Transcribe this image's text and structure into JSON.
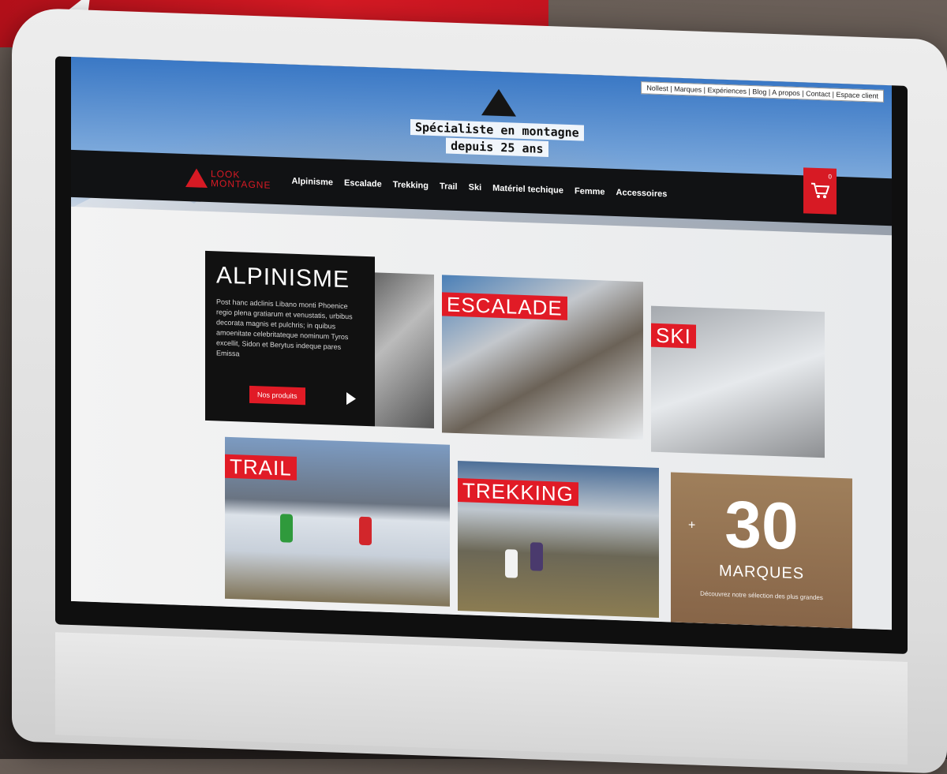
{
  "site": {
    "brand_line1": "LOOK",
    "brand_line2": "MONTAGNE",
    "top_links": "Nollest | Marques | Expériences | Blog | A propos | Contact | Espace client",
    "tagline_line1": "Spécialiste en montagne",
    "tagline_line2": "depuis 25 ans"
  },
  "nav": {
    "items": [
      "Alpinisme",
      "Escalade",
      "Trekking",
      "Trail",
      "Ski",
      "Matériel techique",
      "Femme",
      "Accessoires"
    ]
  },
  "cart": {
    "count": "0",
    "icon": "cart-icon"
  },
  "alpinisme": {
    "title": "ALPINISME",
    "text": "Post hanc adclinis Libano monti Phoenice regio plena gratiarum et venustatis, urbibus decorata magnis et pulchris; in quibus amoenitate celebritateque nominum Tyros excellit, Sidon et Berytus indeque pares Emissa",
    "button": "Nos produits"
  },
  "tiles": {
    "escalade": "ESCALADE",
    "ski": "SKI",
    "trail": "TRAIL",
    "trekking": "TREKKING"
  },
  "brands": {
    "plus": "+",
    "number": "30",
    "label": "MARQUES",
    "subtitle": "Découvrez notre sélection des plus grandes"
  },
  "colors": {
    "accent": "#e11b26",
    "navbar": "#111214"
  }
}
